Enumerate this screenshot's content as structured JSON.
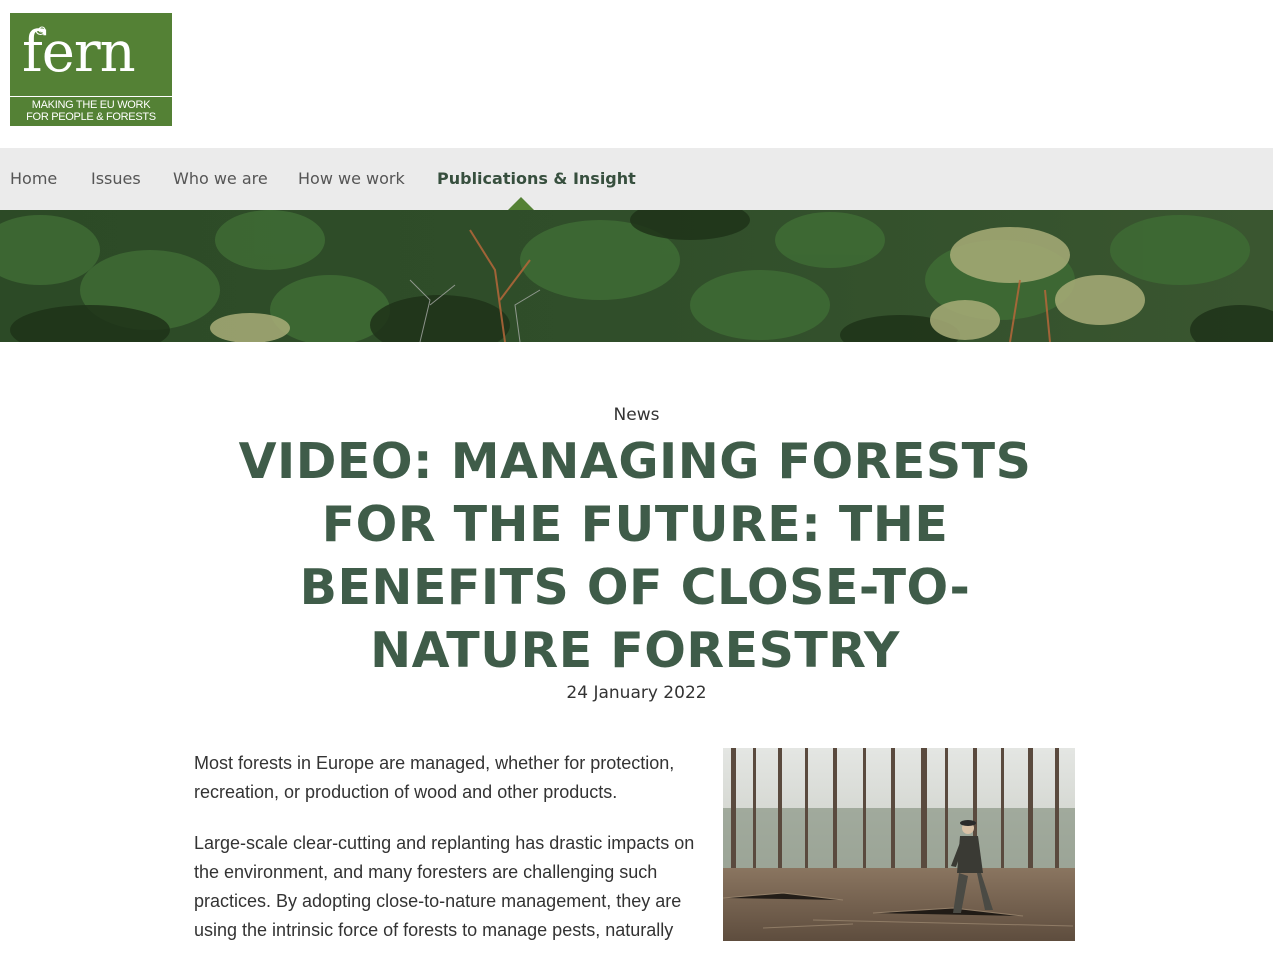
{
  "logo": {
    "word": "fern",
    "tagline_line1": "MAKING THE EU WORK",
    "tagline_line2": "FOR PEOPLE & FORESTS",
    "color": "#548135"
  },
  "nav": {
    "items": [
      {
        "label": "Home",
        "active": false
      },
      {
        "label": "Issues",
        "active": false
      },
      {
        "label": "Who we are",
        "active": false
      },
      {
        "label": "How we work",
        "active": false
      },
      {
        "label": "Publications & Insight",
        "active": true
      }
    ],
    "background": "#ebebeb",
    "active_color": "#374f3e"
  },
  "article": {
    "category": "News",
    "title": "VIDEO: MANAGING FORESTS FOR THE FUTURE: THE BENEFITS OF CLOSE-TO-NATURE FORESTRY",
    "title_color": "#3f5c49",
    "date": "24 January 2022",
    "paragraphs": [
      "Most forests in Europe are managed, whether for protection, recreation, or production of wood and other products.",
      "Large-scale clear-cutting and replanting has drastic impacts on the environment, and many foresters are challenging such practices. By adopting close-to-nature management, they are using the intrinsic force of forests to manage pests, naturally"
    ]
  }
}
